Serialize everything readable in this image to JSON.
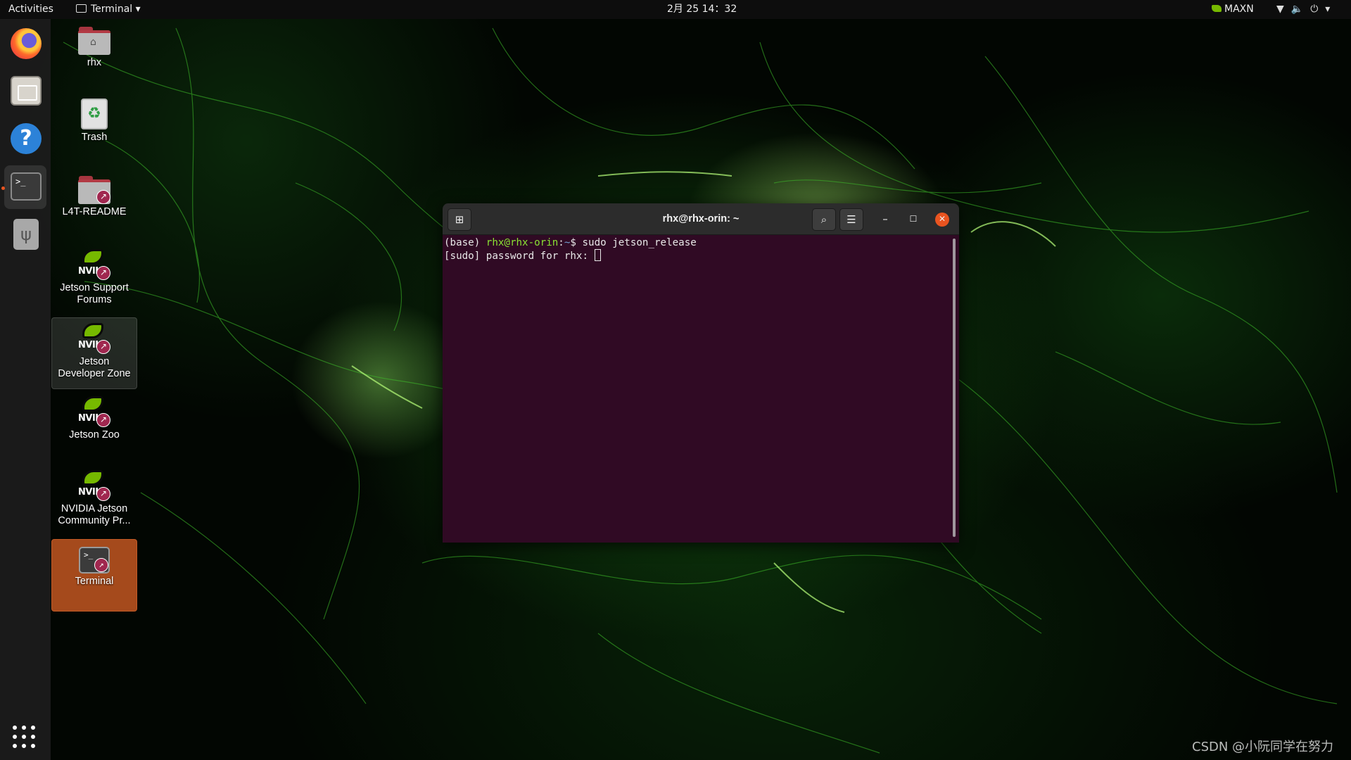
{
  "topbar": {
    "activities": "Activities",
    "app_menu_label": "Terminal",
    "clock": "2月 25  14：32",
    "power_mode": "MAXN"
  },
  "dock": {
    "items": [
      "firefox-icon",
      "files-icon",
      "help-icon",
      "terminal-icon",
      "usb-drive-icon"
    ]
  },
  "desktop": {
    "icons": [
      {
        "label": "rhx"
      },
      {
        "label": "Trash"
      },
      {
        "label": "L4T-README"
      },
      {
        "label": "Jetson Support Forums"
      },
      {
        "label": "Jetson Developer Zone"
      },
      {
        "label": "Jetson Zoo"
      },
      {
        "label": "NVIDIA Jetson Community Pr..."
      },
      {
        "label": "Terminal"
      }
    ],
    "nvidia_logo_text": "NVIL"
  },
  "terminal": {
    "title": "rhx@rhx-orin: ~",
    "env": "(base) ",
    "user_host": "rhx@rhx-orin",
    "path_sep": ":",
    "path": "~",
    "prompt_symbol": "$ ",
    "command": "sudo jetson_release",
    "password_prompt": "[sudo] password for rhx: "
  },
  "watermark": "CSDN @小阮同学在努力",
  "colors": {
    "terminal_background": "#300a24",
    "prompt_user": "#8ae234",
    "prompt_path": "#729fcf",
    "close_button": "#e95420",
    "selection": "#a54a1c",
    "nvidia_green": "#76b900"
  }
}
